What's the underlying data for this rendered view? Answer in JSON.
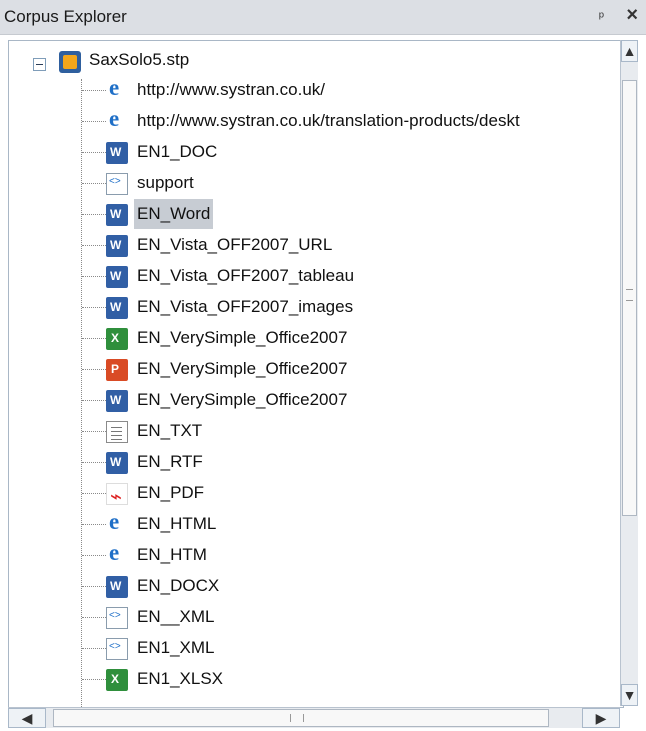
{
  "window": {
    "title": "Corpus Explorer",
    "pin_glyph": "ᵖ",
    "close_glyph": "×"
  },
  "root": {
    "label": "SaxSolo5.stp",
    "icon": "project-icon"
  },
  "items": [
    {
      "label": "http://www.systran.co.uk/",
      "icon": "internet-explorer-icon",
      "type": "ie"
    },
    {
      "label": "http://www.systran.co.uk/translation-products/deskt",
      "icon": "internet-explorer-icon",
      "type": "ie"
    },
    {
      "label": "EN1_DOC",
      "icon": "word-document-icon",
      "type": "word"
    },
    {
      "label": "support",
      "icon": "xml-document-icon",
      "type": "xml"
    },
    {
      "label": "EN_Word",
      "icon": "word-document-icon",
      "type": "word",
      "selected": true
    },
    {
      "label": "EN_Vista_OFF2007_URL",
      "icon": "word-document-icon",
      "type": "word"
    },
    {
      "label": "EN_Vista_OFF2007_tableau",
      "icon": "word-document-icon",
      "type": "word"
    },
    {
      "label": "EN_Vista_OFF2007_images",
      "icon": "word-document-icon",
      "type": "word"
    },
    {
      "label": "EN_VerySimple_Office2007",
      "icon": "excel-document-icon",
      "type": "excel"
    },
    {
      "label": "EN_VerySimple_Office2007",
      "icon": "powerpoint-document-icon",
      "type": "ppt"
    },
    {
      "label": "EN_VerySimple_Office2007",
      "icon": "word-document-icon",
      "type": "word"
    },
    {
      "label": "EN_TXT",
      "icon": "text-document-icon",
      "type": "txt"
    },
    {
      "label": "EN_RTF",
      "icon": "word-document-icon",
      "type": "word"
    },
    {
      "label": "EN_PDF",
      "icon": "pdf-document-icon",
      "type": "pdf"
    },
    {
      "label": "EN_HTML",
      "icon": "internet-explorer-icon",
      "type": "ie"
    },
    {
      "label": "EN_HTM",
      "icon": "internet-explorer-icon",
      "type": "ie"
    },
    {
      "label": "EN_DOCX",
      "icon": "word-document-icon",
      "type": "word"
    },
    {
      "label": "EN__XML",
      "icon": "xml-document-icon",
      "type": "xml"
    },
    {
      "label": "EN1_XML",
      "icon": "xml-document-icon",
      "type": "xml"
    },
    {
      "label": "EN1_XLSX",
      "icon": "excel-document-icon",
      "type": "excel"
    }
  ],
  "scrollbars": {
    "up": "▲",
    "down": "▼",
    "left": "◀",
    "right": "▶"
  },
  "colors": {
    "selection": "#c7ccd3",
    "border": "#a9b7c6"
  }
}
